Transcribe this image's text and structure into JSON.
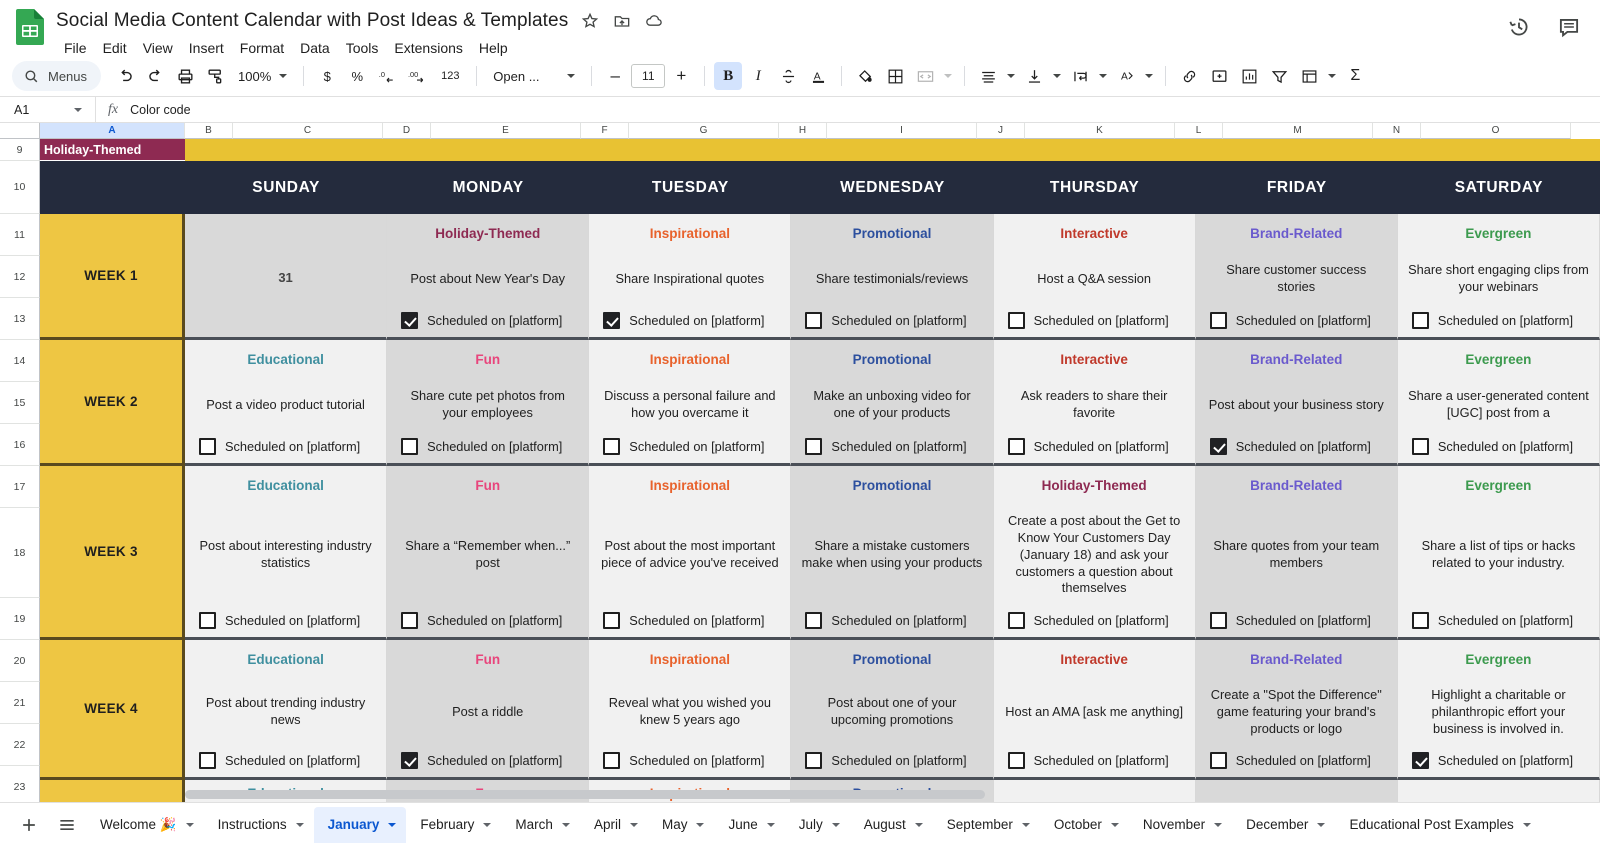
{
  "app": {
    "doc_title": "Social Media Content Calendar with Post Ideas & Templates",
    "menus": [
      "File",
      "Edit",
      "View",
      "Insert",
      "Format",
      "Data",
      "Tools",
      "Extensions",
      "Help"
    ],
    "title_icons": [
      "star-icon",
      "move-icon",
      "cloud-icon"
    ],
    "right_icons": [
      "version-history-icon",
      "comment-icon"
    ]
  },
  "toolbar": {
    "menus_label": "Menus",
    "zoom": "100%",
    "font": "Open ...",
    "font_size": "11",
    "number_123": "123",
    "currency": "$",
    "percent": "%",
    "dec_dec": ".0",
    "inc_dec": ".00",
    "minus": "–",
    "plus": "+",
    "bold": "B",
    "italic": "I",
    "strikethrough": "S",
    "text_color": "A",
    "sigma": "Σ"
  },
  "formula_bar": {
    "name_box": "A1",
    "fx": "fx",
    "value": "Color code"
  },
  "grid": {
    "columns": [
      "A",
      "B",
      "C",
      "D",
      "E",
      "F",
      "G",
      "H",
      "I",
      "J",
      "K",
      "L",
      "M",
      "N",
      "O"
    ],
    "selected_column": "A",
    "row_numbers": [
      "9",
      "10",
      "11",
      "12",
      "13",
      "14",
      "15",
      "16",
      "17",
      "18",
      "19",
      "20",
      "21",
      "22",
      "23"
    ],
    "banner_label": "Holiday-Themed",
    "day_headers": [
      "SUNDAY",
      "MONDAY",
      "TUESDAY",
      "WEDNESDAY",
      "THURSDAY",
      "FRIDAY",
      "SATURDAY"
    ],
    "scheduled_label": "Scheduled on [platform]",
    "date_cell": "31"
  },
  "colors": {
    "week_yellow": "#eec643",
    "banner_yellow": "#e8c233",
    "header_navy": "#242b3d",
    "holiday": "#8e2a52",
    "educational": "#3f8f9f",
    "fun": "#e8457c",
    "inspirational": "#e8622c",
    "promotional": "#2c4f9e",
    "interactive": "#c0392b",
    "brand_related": "#6a5acd",
    "evergreen": "#3c9a4e",
    "accent_blue": "#0b57d0"
  },
  "calendar": {
    "weeks": [
      {
        "label": "WEEK 1",
        "days": [
          {
            "category": "",
            "color": "",
            "idea": "31",
            "checked": false,
            "show_checkbox": false,
            "is_date": true
          },
          {
            "category": "Holiday-Themed",
            "color": "#8e2a52",
            "idea": "Post about New Year's Day",
            "checked": true,
            "show_checkbox": true
          },
          {
            "category": "Inspirational",
            "color": "#e8622c",
            "idea": "Share Inspirational quotes",
            "checked": true,
            "show_checkbox": true
          },
          {
            "category": "Promotional",
            "color": "#2c4f9e",
            "idea": "Share testimonials/reviews",
            "checked": false,
            "show_checkbox": true
          },
          {
            "category": "Interactive",
            "color": "#c0392b",
            "idea": "Host a Q&A session",
            "checked": false,
            "show_checkbox": true
          },
          {
            "category": "Brand-Related",
            "color": "#6a5acd",
            "idea": "Share customer success stories",
            "checked": false,
            "show_checkbox": true
          },
          {
            "category": "Evergreen",
            "color": "#3c9a4e",
            "idea": "Share short engaging clips from your webinars",
            "checked": false,
            "show_checkbox": true
          }
        ]
      },
      {
        "label": "WEEK 2",
        "days": [
          {
            "category": "Educational",
            "color": "#3f8f9f",
            "idea": "Post a video product tutorial",
            "checked": false,
            "show_checkbox": true
          },
          {
            "category": "Fun",
            "color": "#e8457c",
            "idea": "Share cute pet photos from your employees",
            "checked": false,
            "show_checkbox": true
          },
          {
            "category": "Inspirational",
            "color": "#e8622c",
            "idea": "Discuss a personal failure and how you overcame it",
            "checked": false,
            "show_checkbox": true
          },
          {
            "category": "Promotional",
            "color": "#2c4f9e",
            "idea": "Make an unboxing video for one of your products",
            "checked": false,
            "show_checkbox": true
          },
          {
            "category": "Interactive",
            "color": "#c0392b",
            "idea": "Ask readers to share their favorite",
            "checked": false,
            "show_checkbox": true
          },
          {
            "category": "Brand-Related",
            "color": "#6a5acd",
            "idea": "Post about your business story",
            "checked": true,
            "show_checkbox": true
          },
          {
            "category": "Evergreen",
            "color": "#3c9a4e",
            "idea": "Share a user-generated content [UGC] post from a",
            "checked": false,
            "show_checkbox": true
          }
        ]
      },
      {
        "label": "WEEK 3",
        "days": [
          {
            "category": "Educational",
            "color": "#3f8f9f",
            "idea": "Post about interesting industry statistics",
            "checked": false,
            "show_checkbox": true
          },
          {
            "category": "Fun",
            "color": "#e8457c",
            "idea": "Share a “Remember when...” post",
            "checked": false,
            "show_checkbox": true
          },
          {
            "category": "Inspirational",
            "color": "#e8622c",
            "idea": "Post about the most important piece of advice you've received",
            "checked": false,
            "show_checkbox": true
          },
          {
            "category": "Promotional",
            "color": "#2c4f9e",
            "idea": "Share a mistake customers make when using your products",
            "checked": false,
            "show_checkbox": true
          },
          {
            "category": "Holiday-Themed",
            "color": "#8e2a52",
            "idea": "Create a post about the Get to Know Your Customers Day (January 18) and ask your customers a question about themselves",
            "checked": false,
            "show_checkbox": true
          },
          {
            "category": "Brand-Related",
            "color": "#6a5acd",
            "idea": "Share quotes from your team members",
            "checked": false,
            "show_checkbox": true
          },
          {
            "category": "Evergreen",
            "color": "#3c9a4e",
            "idea": "Share a list of tips or hacks related to your industry.",
            "checked": false,
            "show_checkbox": true
          }
        ]
      },
      {
        "label": "WEEK 4",
        "days": [
          {
            "category": "Educational",
            "color": "#3f8f9f",
            "idea": "Post about trending industry news",
            "checked": false,
            "show_checkbox": true
          },
          {
            "category": "Fun",
            "color": "#e8457c",
            "idea": "Post a riddle",
            "checked": true,
            "show_checkbox": true
          },
          {
            "category": "Inspirational",
            "color": "#e8622c",
            "idea": "Reveal what you wished you knew 5 years ago",
            "checked": false,
            "show_checkbox": true
          },
          {
            "category": "Promotional",
            "color": "#2c4f9e",
            "idea": "Post about one of your upcoming promotions",
            "checked": false,
            "show_checkbox": true
          },
          {
            "category": "Interactive",
            "color": "#c0392b",
            "idea": "Host an AMA [ask me anything]",
            "checked": false,
            "show_checkbox": true
          },
          {
            "category": "Brand-Related",
            "color": "#6a5acd",
            "idea": "Create a \"Spot the Difference\" game featuring your brand's products or logo",
            "checked": false,
            "show_checkbox": true
          },
          {
            "category": "Evergreen",
            "color": "#3c9a4e",
            "idea": "Highlight a charitable or philanthropic effort your business is involved in.",
            "checked": true,
            "show_checkbox": true
          }
        ]
      },
      {
        "label": "",
        "partial": true,
        "days": [
          {
            "category": "Educational",
            "color": "#3f8f9f",
            "idea": "",
            "checked": false,
            "show_checkbox": false
          },
          {
            "category": "Fun",
            "color": "#e8457c",
            "idea": "",
            "checked": false,
            "show_checkbox": false
          },
          {
            "category": "Inspirational",
            "color": "#e8622c",
            "idea": "",
            "checked": false,
            "show_checkbox": false
          },
          {
            "category": "Promotional",
            "color": "#2c4f9e",
            "idea": "",
            "checked": false,
            "show_checkbox": false
          },
          {
            "category": "",
            "color": "",
            "idea": "",
            "checked": false,
            "show_checkbox": false
          },
          {
            "category": "",
            "color": "",
            "idea": "",
            "checked": false,
            "show_checkbox": false
          },
          {
            "category": "",
            "color": "",
            "idea": "",
            "checked": false,
            "show_checkbox": false
          }
        ]
      }
    ]
  },
  "sheet_tabs": {
    "add_label": "+",
    "all_sheets_label": "all-sheets",
    "tabs": [
      {
        "label": "Welcome 🎉",
        "active": false
      },
      {
        "label": "Instructions",
        "active": false
      },
      {
        "label": "January",
        "active": true
      },
      {
        "label": "February",
        "active": false
      },
      {
        "label": "March",
        "active": false
      },
      {
        "label": "April",
        "active": false
      },
      {
        "label": "May",
        "active": false
      },
      {
        "label": "June",
        "active": false
      },
      {
        "label": "July",
        "active": false
      },
      {
        "label": "August",
        "active": false
      },
      {
        "label": "September",
        "active": false
      },
      {
        "label": "October",
        "active": false
      },
      {
        "label": "November",
        "active": false
      },
      {
        "label": "December",
        "active": false
      },
      {
        "label": "Educational Post Examples",
        "active": false
      }
    ]
  }
}
